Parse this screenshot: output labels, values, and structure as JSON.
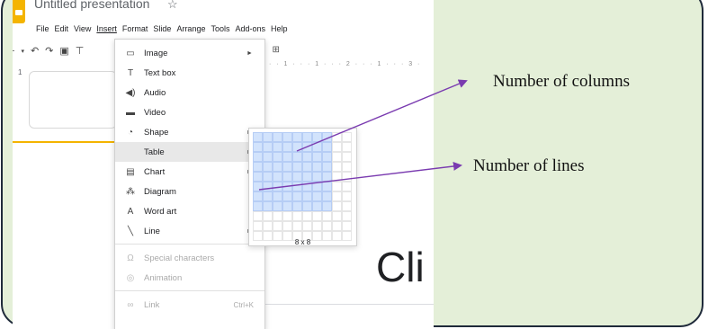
{
  "app": {
    "title": "Untitled presentation",
    "star_icon": "☆"
  },
  "menubar": [
    "File",
    "Edit",
    "View",
    "Insert",
    "Format",
    "Slide",
    "Arrange",
    "Tools",
    "Add-ons",
    "Help"
  ],
  "menubar_active": "Insert",
  "slides": {
    "thumb_number": "1"
  },
  "ruler": "· · 1 · · · 1 · · · 2 · · · 1 · · · 3 ·",
  "insert_menu": {
    "items": [
      {
        "label": "Image",
        "icon": "image-icon",
        "glyph": "▭",
        "submenu": true
      },
      {
        "label": "Text box",
        "icon": "textbox-icon",
        "glyph": "T",
        "submenu": false
      },
      {
        "label": "Audio",
        "icon": "audio-icon",
        "glyph": "◀)",
        "submenu": false
      },
      {
        "label": "Video",
        "icon": "video-icon",
        "glyph": "▬",
        "submenu": false
      },
      {
        "label": "Shape",
        "icon": "shape-icon",
        "glyph": "◔",
        "submenu": true
      },
      {
        "label": "Table",
        "icon": "",
        "glyph": "",
        "submenu": true
      },
      {
        "label": "Chart",
        "icon": "chart-icon",
        "glyph": "▤",
        "submenu": true
      },
      {
        "label": "Diagram",
        "icon": "diagram-icon",
        "glyph": "⁂",
        "submenu": false
      },
      {
        "label": "Word art",
        "icon": "word-art-icon",
        "glyph": "A",
        "submenu": false
      },
      {
        "label": "Line",
        "icon": "line-icon",
        "glyph": "╲",
        "submenu": true
      }
    ],
    "disabled_items": [
      {
        "label": "Special characters",
        "icon": "omega-icon",
        "glyph": "Ω"
      },
      {
        "label": "Animation",
        "icon": "animation-icon",
        "glyph": "◎"
      }
    ],
    "link": {
      "label": "Link",
      "shortcut": "Ctrl+K",
      "icon": "link-icon",
      "glyph": "∞"
    }
  },
  "table_grid": {
    "size_label": "8 x 8",
    "selected_cols": 8,
    "selected_rows": 8,
    "total_cols": 10,
    "total_rows": 11
  },
  "slide_text": "Cli",
  "annotations": {
    "columns": "Number of columns",
    "lines": "Number of lines"
  },
  "colors": {
    "background": "#e4efd8",
    "arrow": "#7a3bb0",
    "grid_selected": "#d2e3fc",
    "brand": "#f4b400"
  }
}
